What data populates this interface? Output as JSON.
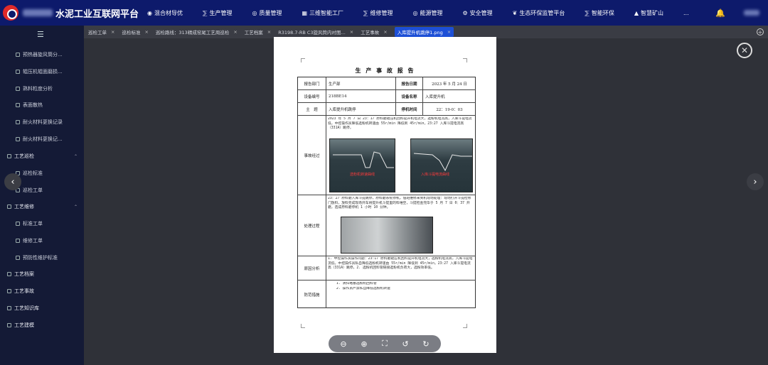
{
  "app": {
    "title": "水泥工业互联网平台"
  },
  "nav": [
    {
      "icon": "globe-icon",
      "label": "混合材导优"
    },
    {
      "icon": "flow-icon",
      "label": "生产管理"
    },
    {
      "icon": "location-icon",
      "label": "质量管理"
    },
    {
      "icon": "factory-icon",
      "label": "三维智能工厂"
    },
    {
      "icon": "flow-icon",
      "label": "维修管理"
    },
    {
      "icon": "location-icon",
      "label": "能源管理"
    },
    {
      "icon": "gear-icon",
      "label": "安全管理"
    },
    {
      "icon": "leaf-icon",
      "label": "生态环保监管平台"
    },
    {
      "icon": "flow-icon",
      "label": "智能环保"
    },
    {
      "icon": "mountain-icon",
      "label": "智慧矿山"
    },
    {
      "icon": "",
      "label": "..."
    }
  ],
  "sidebar": {
    "items": [
      {
        "label": "预热器旋风筒分...",
        "type": "leaf"
      },
      {
        "label": "辊压机辊面磨损...",
        "type": "leaf"
      },
      {
        "label": "熟料粒度分析",
        "type": "leaf"
      },
      {
        "label": "表面散热",
        "type": "leaf"
      },
      {
        "label": "耐火材料更换记录",
        "type": "leaf"
      },
      {
        "label": "耐火材料更换记...",
        "type": "leaf"
      },
      {
        "label": "工艺巡检",
        "type": "group"
      },
      {
        "label": "巡检标准",
        "type": "leaf"
      },
      {
        "label": "巡检工单",
        "type": "leaf"
      },
      {
        "label": "工艺维修",
        "type": "group"
      },
      {
        "label": "标准工单",
        "type": "leaf"
      },
      {
        "label": "维修工单",
        "type": "leaf"
      },
      {
        "label": "预防性维护标准",
        "type": "leaf"
      },
      {
        "label": "工艺档案",
        "type": "top"
      },
      {
        "label": "工艺事故",
        "type": "top"
      },
      {
        "label": "工艺知识库",
        "type": "top"
      },
      {
        "label": "工艺建模",
        "type": "top"
      }
    ]
  },
  "tabs": [
    {
      "label": "巡检工单"
    },
    {
      "label": "巡检标准"
    },
    {
      "label": "巡检路线：313精成窑尾工艺周巡检"
    },
    {
      "label": "工艺档案"
    },
    {
      "label": "R3198.7-RB C3旋风筒内衬图..."
    },
    {
      "label": "工艺事故"
    },
    {
      "label": "入库提升机跳停1.png",
      "active": true
    }
  ],
  "report": {
    "title": "生 产 事 故 报 告",
    "dept_label": "报告部门",
    "dept_value": "生产部",
    "date_label": "报告日期",
    "date_value": "2023 年 5 月 24 日",
    "equip_no_label": "设备编号",
    "equip_no_value": "218BE14",
    "equip_name_label": "设备名称",
    "equip_name_value": "入库提升机",
    "subject_label": "主　题",
    "subject_value": "入库提升机跳停",
    "downtime_label": "停机时间",
    "downtime_value": "22：19-0：03",
    "process_label": "事故经过",
    "process_text": "2023 年 5 月 7 日 23：17 原料磨辊压机回料提升机电流大，选粉机电流高，入库斗提电流低，中控操作员降低选粉机转速由 55r/min 降低到 45r/min，23:27 入库斗提电流高（331A）跳停，",
    "photo1_label": "选粉机转速曲线",
    "photo2_label": "入库斗提电流曲线",
    "handling_label": "处理过程",
    "handling_text": "23：27 原料磨入库斗提跳停，原料磨系统停机，值班维修来到机现场处理：现场打开斗提检修门放料，放料完成现场开车将提升机斗提里的料堆空，斗提检查完毕于 5 月 7 日 0：37 开磨，造成原料磨停机 1 小时 10 分钟。",
    "cause_label": "原因分析",
    "cause_text": "1. 中控操作员操作问题：23:17 原料磨辊压机回料提升机电流大，选粉机电流高，入库斗提电流低，中控操作员私自降低选粉机转速由 55r/min 降低到 45r/min，23:27 入库斗提电流高（331A）跳停。2. 选粉机回料管链接选粉机负荷大，选粉效率低。",
    "prevent_label": "防范措施",
    "prevent_items": [
      "1. 清扫堵塞选粉机回料管",
      "2. 操作员严禁私自降低选粉机转速"
    ]
  },
  "toolbar": {
    "zoom_out": "−",
    "zoom_in": "+",
    "fit": "⛶",
    "rotate_left": "↺",
    "rotate_right": "↻"
  }
}
